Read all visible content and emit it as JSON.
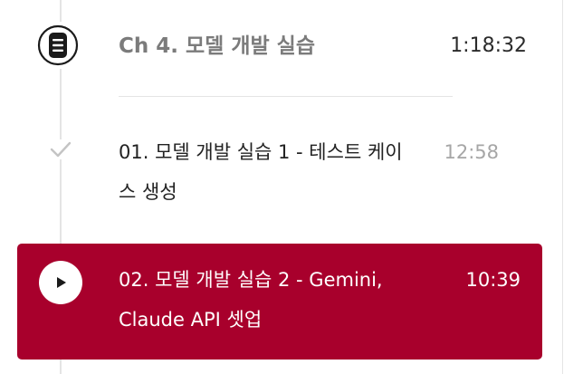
{
  "chapter": {
    "icon": "list-document-icon",
    "title": "Ch 4. 모델 개발 실습",
    "duration": "1:18:32"
  },
  "lessons": [
    {
      "icon": "check-icon",
      "status": "completed",
      "title": "01. 모델 개발 실습 1 - 테스트 케이스 생성",
      "duration": "12:58"
    },
    {
      "icon": "play-icon",
      "status": "playing",
      "title": "02. 모델 개발 실습 2 - Gemini, Claude API 셋업",
      "duration": "10:39"
    }
  ],
  "colors": {
    "active_background": "#a8002c",
    "timeline": "#e4e4e4",
    "chapter_title": "#7b7b7b",
    "completed_duration": "#a6a6a6"
  }
}
